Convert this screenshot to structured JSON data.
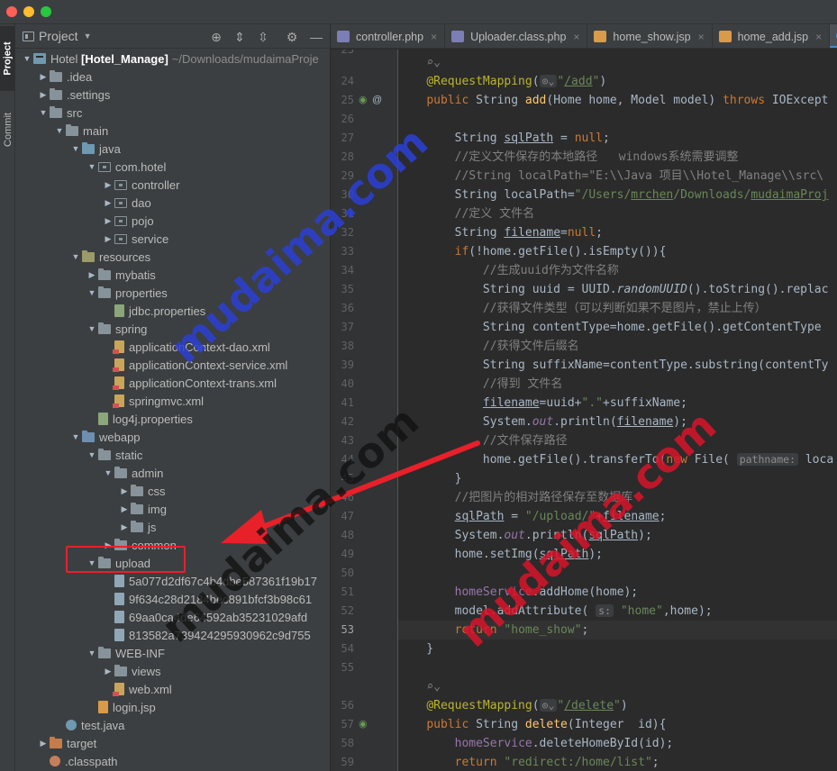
{
  "sidebar": {
    "project_tab": "Project",
    "commit_tab": "Commit"
  },
  "project_panel": {
    "title": "Project",
    "dropdown_icon": "chevron-down-icon"
  },
  "tree": [
    {
      "label": "Hotel",
      "bold": "[Hotel_Manage]",
      "path": "~/Downloads/mudaimaProje",
      "depth": 0,
      "arrow": "open",
      "icon": "mod"
    },
    {
      "label": ".idea",
      "depth": 1,
      "arrow": "closed",
      "icon": "folder"
    },
    {
      "label": ".settings",
      "depth": 1,
      "arrow": "closed",
      "icon": "folder"
    },
    {
      "label": "src",
      "depth": 1,
      "arrow": "open",
      "icon": "folder"
    },
    {
      "label": "main",
      "depth": 2,
      "arrow": "open",
      "icon": "folder"
    },
    {
      "label": "java",
      "depth": 3,
      "arrow": "open",
      "icon": "src"
    },
    {
      "label": "com.hotel",
      "depth": 4,
      "arrow": "open",
      "icon": "pkg"
    },
    {
      "label": "controller",
      "depth": 5,
      "arrow": "closed",
      "icon": "pkg"
    },
    {
      "label": "dao",
      "depth": 5,
      "arrow": "closed",
      "icon": "pkg"
    },
    {
      "label": "pojo",
      "depth": 5,
      "arrow": "closed",
      "icon": "pkg"
    },
    {
      "label": "service",
      "depth": 5,
      "arrow": "closed",
      "icon": "pkg"
    },
    {
      "label": "resources",
      "depth": 3,
      "arrow": "open",
      "icon": "res"
    },
    {
      "label": "mybatis",
      "depth": 4,
      "arrow": "closed",
      "icon": "folder"
    },
    {
      "label": "properties",
      "depth": 4,
      "arrow": "open",
      "icon": "folder"
    },
    {
      "label": "jdbc.properties",
      "depth": 5,
      "arrow": "none",
      "icon": "prop"
    },
    {
      "label": "spring",
      "depth": 4,
      "arrow": "open",
      "icon": "folder"
    },
    {
      "label": "applicationContext-dao.xml",
      "depth": 5,
      "arrow": "none",
      "icon": "xml"
    },
    {
      "label": "applicationContext-service.xml",
      "depth": 5,
      "arrow": "none",
      "icon": "xml"
    },
    {
      "label": "applicationContext-trans.xml",
      "depth": 5,
      "arrow": "none",
      "icon": "xml"
    },
    {
      "label": "springmvc.xml",
      "depth": 5,
      "arrow": "none",
      "icon": "xml"
    },
    {
      "label": "log4j.properties",
      "depth": 4,
      "arrow": "none",
      "icon": "prop"
    },
    {
      "label": "webapp",
      "depth": 3,
      "arrow": "open",
      "icon": "web"
    },
    {
      "label": "static",
      "depth": 4,
      "arrow": "open",
      "icon": "folder"
    },
    {
      "label": "admin",
      "depth": 5,
      "arrow": "open",
      "icon": "folder"
    },
    {
      "label": "css",
      "depth": 6,
      "arrow": "closed",
      "icon": "folder"
    },
    {
      "label": "img",
      "depth": 6,
      "arrow": "closed",
      "icon": "folder"
    },
    {
      "label": "js",
      "depth": 6,
      "arrow": "closed",
      "icon": "folder"
    },
    {
      "label": "common",
      "depth": 5,
      "arrow": "closed",
      "icon": "folder"
    },
    {
      "label": "upload",
      "depth": 4,
      "arrow": "open",
      "icon": "folder"
    },
    {
      "label": "5a077d2df67c4b4dbe587361f19b17",
      "depth": 5,
      "arrow": "none",
      "icon": "img"
    },
    {
      "label": "9f634c28d2184bec891bfcf3b98c61",
      "depth": 5,
      "arrow": "none",
      "icon": "img"
    },
    {
      "label": "69aa0ca4de64592ab35231029afd",
      "depth": 5,
      "arrow": "none",
      "icon": "img"
    },
    {
      "label": "813582a739424295930962c9d755",
      "depth": 5,
      "arrow": "none",
      "icon": "img"
    },
    {
      "label": "WEB-INF",
      "depth": 4,
      "arrow": "open",
      "icon": "folder"
    },
    {
      "label": "views",
      "depth": 5,
      "arrow": "closed",
      "icon": "folder"
    },
    {
      "label": "web.xml",
      "depth": 5,
      "arrow": "none",
      "icon": "xml"
    },
    {
      "label": "login.jsp",
      "depth": 4,
      "arrow": "none",
      "icon": "jsp"
    },
    {
      "label": "test.java",
      "depth": 2,
      "arrow": "none",
      "icon": "java"
    },
    {
      "label": "target",
      "depth": 1,
      "arrow": "closed",
      "icon": "excl"
    },
    {
      "label": ".classpath",
      "depth": 1,
      "arrow": "none",
      "icon": "cls"
    }
  ],
  "tabs": [
    {
      "label": "controller.php",
      "icon": "php"
    },
    {
      "label": "Uploader.class.php",
      "icon": "php"
    },
    {
      "label": "home_show.jsp",
      "icon": "jspi"
    },
    {
      "label": "home_add.jsp",
      "icon": "jspi"
    },
    {
      "label": "Ho",
      "icon": "cls"
    }
  ],
  "editor": {
    "first_line_partial": "23",
    "lines": [
      {
        "n": "",
        "html": "    <span class=\"c\">⌕⌄</span>"
      },
      {
        "n": "24",
        "html": "    <span class=\"a\">@RequestMapping</span>(<span class=\"hint\">⊙⌄</span><span class=\"s\">\"<span class=\"u\">/add</span>\"</span>)"
      },
      {
        "n": "25",
        "html": "    <span class=\"k\">public</span> String <span class=\"f\">add</span>(Home home, Model model) <span class=\"k\">throws</span> IOExcept"
      },
      {
        "n": "26",
        "html": ""
      },
      {
        "n": "27",
        "html": "        String <span class=\"u\">sqlPath</span> = <span class=\"k\">null</span>;"
      },
      {
        "n": "28",
        "html": "        <span class=\"c\">//定义文件保存的本地路径   windows系统需要调整</span>"
      },
      {
        "n": "29",
        "html": "        <span class=\"c\">//String localPath=\"E:\\\\Java 项目\\\\Hotel_Manage\\\\src\\</span>"
      },
      {
        "n": "30",
        "html": "        String localPath=<span class=\"s\">\"/Users/<span class=\"u\">mrchen</span>/Downloads/<span class=\"u\">mudaimaProj</span></span>"
      },
      {
        "n": "31",
        "html": "        <span class=\"c\">//定义 文件名</span>"
      },
      {
        "n": "32",
        "html": "        String <span class=\"u\">filename</span>=<span class=\"k\">null</span>;"
      },
      {
        "n": "33",
        "html": "        <span class=\"k\">if</span>(!home.getFile().isEmpty()){"
      },
      {
        "n": "34",
        "html": "            <span class=\"c\">//生成uuid作为文件名称</span>"
      },
      {
        "n": "35",
        "html": "            String uuid = UUID.<span class=\"it\">randomUUID</span>().toString().replac"
      },
      {
        "n": "36",
        "html": "            <span class=\"c\">//获得文件类型（可以判断如果不是图片，禁止上传）</span>"
      },
      {
        "n": "37",
        "html": "            String contentType=home.getFile().getContentType"
      },
      {
        "n": "38",
        "html": "            <span class=\"c\">//获得文件后缀名</span>"
      },
      {
        "n": "39",
        "html": "            String suffixName=contentType.substring(contentTy"
      },
      {
        "n": "40",
        "html": "            <span class=\"c\">//得到 文件名</span>"
      },
      {
        "n": "41",
        "html": "            <span class=\"u\">filename</span>=uuid+<span class=\"s\">\".\"</span>+suffixName;"
      },
      {
        "n": "42",
        "html": "            System.<span class=\"fld it\">out</span>.println(<span class=\"u\">filename</span>);"
      },
      {
        "n": "43",
        "html": "            <span class=\"c\">//文件保存路径</span>"
      },
      {
        "n": "44",
        "html": "            home.getFile().transferTo(<span class=\"k\">new</span> File( <span class=\"hint\">pathname:</span> loca"
      },
      {
        "n": "45",
        "html": "        }"
      },
      {
        "n": "46",
        "html": "        <span class=\"c\">//把图片的相对路径保存至数据库</span>"
      },
      {
        "n": "47",
        "html": "        <span class=\"u\">sqlPath</span> = <span class=\"s\">\"/upload/\"</span>+<span class=\"u\">filename</span>;"
      },
      {
        "n": "48",
        "html": "        System.<span class=\"fld it\">out</span>.println(<span class=\"u\">sqlPath</span>);"
      },
      {
        "n": "49",
        "html": "        home.setImg(<span class=\"u\">sqlPath</span>);"
      },
      {
        "n": "50",
        "html": ""
      },
      {
        "n": "51",
        "html": "        <span class=\"fld\">homeService</span>.addHome(home);"
      },
      {
        "n": "52",
        "html": "        model.addAttribute( <span class=\"hint\">s:</span> <span class=\"s\">\"home\"</span>,home);"
      },
      {
        "n": "53",
        "html": "        <span class=\"k\">return</span> <span class=\"s\">\"home_show\"</span>;",
        "current": true
      },
      {
        "n": "54",
        "html": "    }"
      },
      {
        "n": "55",
        "html": ""
      },
      {
        "n": "",
        "html": "    <span class=\"c\">⌕⌄</span>"
      },
      {
        "n": "56",
        "html": "    <span class=\"a\">@RequestMapping</span>(<span class=\"hint\">⊙⌄</span><span class=\"s\">\"<span class=\"u\">/delete</span>\"</span>)"
      },
      {
        "n": "57",
        "html": "    <span class=\"k\">public</span> String <span class=\"f\">delete</span>(Integer  id){"
      },
      {
        "n": "58",
        "html": "        <span class=\"fld\">homeService</span>.deleteHomeById(id);"
      },
      {
        "n": "59",
        "html": "        <span class=\"k\">return</span> <span class=\"s\">\"redirect:/home/list\"</span>;"
      },
      {
        "n": "",
        "html": "    }"
      }
    ]
  },
  "watermarks": {
    "text": "mudaima.com"
  },
  "colors": {
    "accent": "#4a88c7",
    "highlight_red": "#e8202a"
  }
}
